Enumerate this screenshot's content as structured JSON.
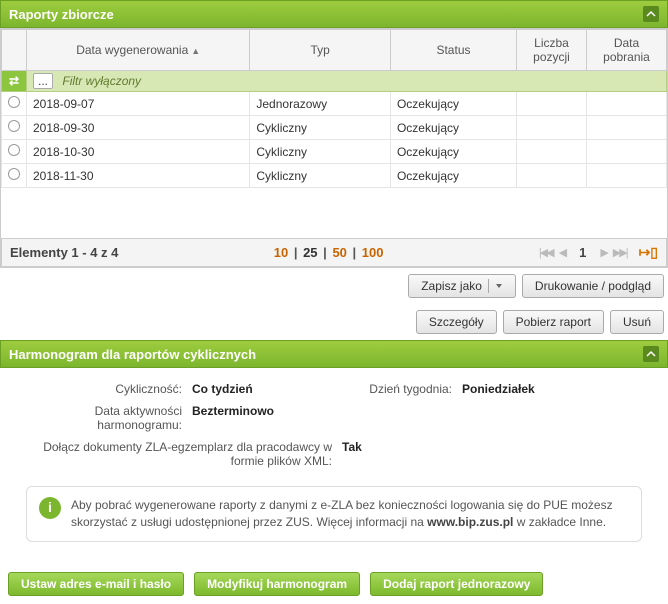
{
  "panel1": {
    "title": "Raporty zbiorcze"
  },
  "columns": {
    "c1": "Data wygenerowania",
    "c2": "Typ",
    "c3": "Status",
    "c4": "Liczba pozycji",
    "c5": "Data pobrania"
  },
  "filter": {
    "label": "Filtr wyłączony",
    "btn": "..."
  },
  "rows": [
    {
      "date": "2018-09-07",
      "type": "Jednorazowy",
      "status": "Oczekujący",
      "count": "",
      "downloaded": ""
    },
    {
      "date": "2018-09-30",
      "type": "Cykliczny",
      "status": "Oczekujący",
      "count": "",
      "downloaded": ""
    },
    {
      "date": "2018-10-30",
      "type": "Cykliczny",
      "status": "Oczekujący",
      "count": "",
      "downloaded": ""
    },
    {
      "date": "2018-11-30",
      "type": "Cykliczny",
      "status": "Oczekujący",
      "count": "",
      "downloaded": ""
    }
  ],
  "pager": {
    "summary": "Elementy 1 - 4 z 4",
    "sizes": [
      "10",
      "25",
      "50",
      "100"
    ],
    "active_size": "25",
    "current_page": "1"
  },
  "actions1": {
    "save_as": "Zapisz jako",
    "print": "Drukowanie / podgląd"
  },
  "actions2": {
    "details": "Szczegóły",
    "download": "Pobierz raport",
    "delete": "Usuń"
  },
  "panel2": {
    "title": "Harmonogram dla raportów cyklicznych"
  },
  "details": {
    "freq_label": "Cykliczność:",
    "freq_value": "Co tydzień",
    "dow_label": "Dzień tygodnia:",
    "dow_value": "Poniedziałek",
    "active_label": "Data aktywności harmonogramu:",
    "active_value": "Bezterminowo",
    "zla_label": "Dołącz dokumenty ZLA-egzemplarz dla pracodawcy w formie plików XML:",
    "zla_value": "Tak"
  },
  "info": {
    "text_a": "Aby pobrać wygenerowane raporty z danymi z e-ZLA bez konieczności logowania się do PUE możesz skorzystać z usługi udostępnionej przez ZUS. Więcej informacji na ",
    "link": "www.bip.zus.pl",
    "text_b": " w zakładce Inne."
  },
  "actions3": {
    "set_email": "Ustaw adres e-mail i hasło",
    "modify": "Modyfikuj harmonogram",
    "add_one": "Dodaj raport jednorazowy"
  }
}
